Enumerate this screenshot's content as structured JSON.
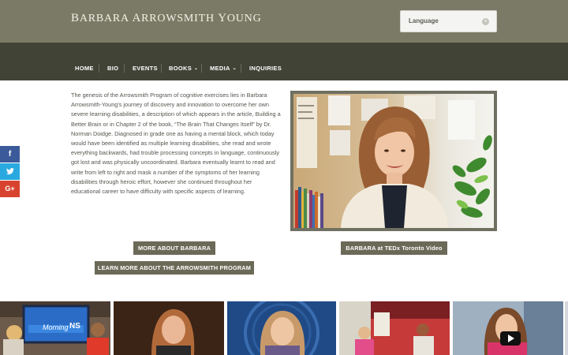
{
  "site": {
    "title_first": "B",
    "title_rest": "ARBARA ",
    "title_first2": "A",
    "title_rest2": "RROWSMITH ",
    "title_first3": "Y",
    "title_rest3": "OUNG"
  },
  "language_select": {
    "label": "Language",
    "clear_icon": "close-icon"
  },
  "nav": {
    "items": [
      {
        "label": "HOME",
        "has_dropdown": false
      },
      {
        "label": "BIO",
        "has_dropdown": false
      },
      {
        "label": "EVENTS",
        "has_dropdown": false
      },
      {
        "label": "BOOKS",
        "has_dropdown": true
      },
      {
        "label": "MEDIA",
        "has_dropdown": true
      },
      {
        "label": "INQUIRIES",
        "has_dropdown": false
      }
    ],
    "caret": "⌄"
  },
  "social": {
    "facebook": "f",
    "twitter": "t",
    "googleplus": "G+"
  },
  "intro": {
    "text": "The genesis of the Arrowsmith Program of cognitive exercises lies in Barbara Arrowsmith-Young's journey of discovery and innovation to overcome her own severe learning disabilities, a description of which appears in the article, Building a Better Brain or in Chapter 2 of the book, “The Brain That Changes Itself” by Dr. Norman Doidge. Diagnosed in grade one as having a mental block, which today would have been identified as multiple learning disabilities, she read and wrote everything backwards, had trouble processing concepts in language, continuously got lost and was physically uncoordinated. Barbara eventually learnt to read and write from left to right and mask a number of the symptoms of her learning disabilities through heroic effort, however she continued throughout her educational career to have difficulty with specific aspects of learning."
  },
  "buttons": {
    "more_about": "MORE ABOUT BARBARA",
    "tedx": "BARBARA at TEDx Toronto Video",
    "learn_more": "LEARN MORE ABOUT THE ARROWSMITH PROGRAM"
  },
  "thumbnails": {
    "first_caption": "Morning",
    "first_caption2": "NS"
  },
  "colors": {
    "topbar": "#7b7a66",
    "navbar": "#424337",
    "button": "#6b6a58",
    "facebook": "#3b5a9a",
    "twitter": "#2aa9e0",
    "googleplus": "#d8432f"
  }
}
